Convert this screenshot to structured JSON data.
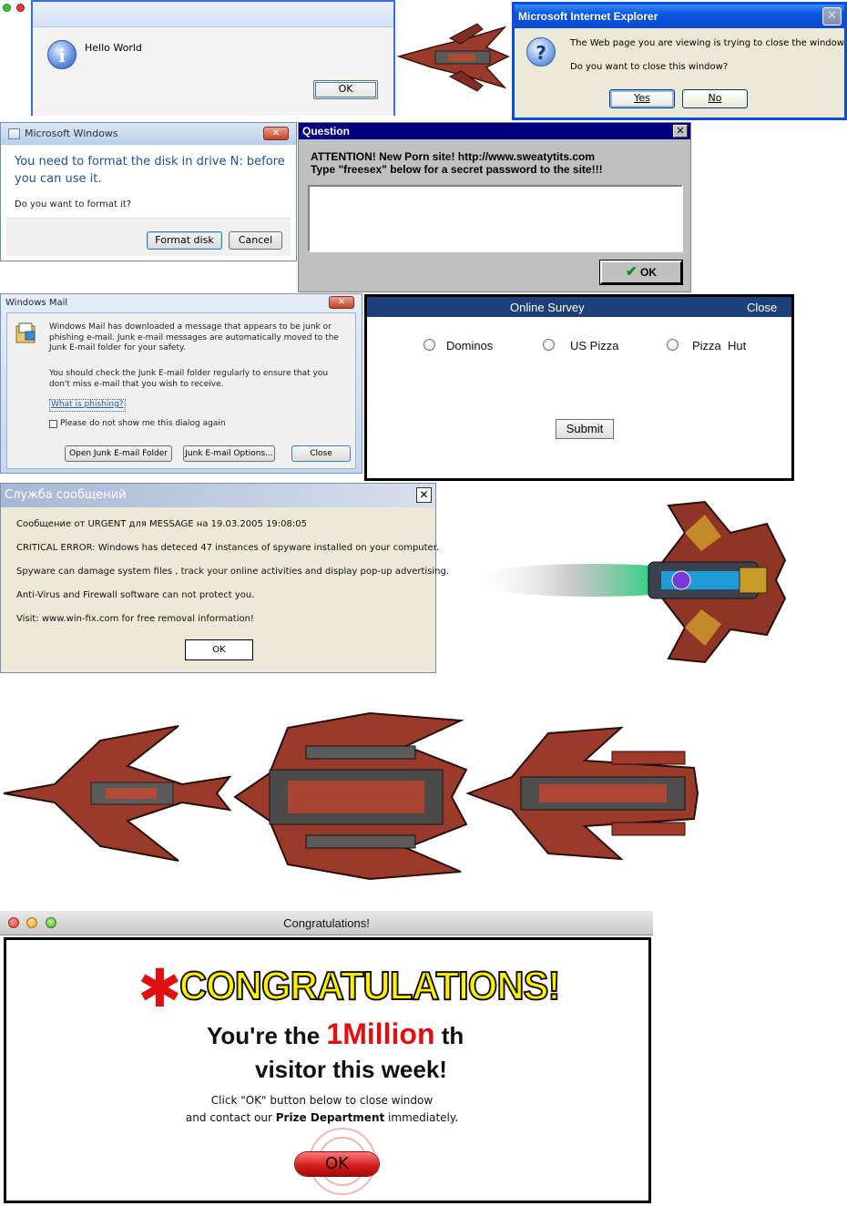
{
  "hello_dialog": {
    "message": "Hello World",
    "ok": "OK",
    "icon": "info-icon"
  },
  "ie_dialog": {
    "title": "Microsoft Internet Explorer",
    "line1": "The Web page you are viewing is trying to close the window.",
    "line2": "Do you want to close this window?",
    "yes": "Yes",
    "no": "No",
    "close": "✕",
    "icon": "question-icon"
  },
  "format_dialog": {
    "title": "Microsoft Windows",
    "heading": "You need to format the disk in drive N: before you can use it.",
    "question": "Do you want to format it?",
    "format": "Format disk",
    "cancel": "Cancel",
    "close": "✕"
  },
  "question_dialog": {
    "title": "Question",
    "line1": "ATTENTION! New Porn site! http://www.sweatytits.com",
    "line2": "Type \"freesex\" below for a secret password to the site!!!",
    "input_value": "",
    "ok": "OK",
    "close": "✕"
  },
  "mail_dialog": {
    "title": "Windows Mail",
    "para1": "Windows Mail has downloaded a message that appears to be junk or phishing e-mail. Junk e-mail messages are automatically moved to the Junk E-mail folder for your safety.",
    "para2": "You should check the Junk E-mail folder regularly to ensure that you don't miss e-mail that you wish to receive.",
    "link": "What is phishing?",
    "checkbox": "Please do not show me this dialog again",
    "btn_open": "Open Junk E-mail Folder",
    "btn_options": "Junk E-mail Options...",
    "btn_close": "Close",
    "close": "✕"
  },
  "survey": {
    "title": "Online Survey",
    "close": "Close",
    "options": [
      "Dominos",
      "US Pizza",
      "Pizza  Hut"
    ],
    "submit": "Submit"
  },
  "ru_dialog": {
    "title": "Служба сообщений",
    "close": "✕",
    "lines": [
      "Сообщение от URGENT для MESSAGE на 19.03.2005 19:08:05",
      "CRITICAL ERROR: Windows has deteced 47 instances of spyware installed on your computer.",
      "Spyware can damage system files , track your online activities and display pop-up advertising.",
      "Anti-Virus and Firewall software can not protect you.",
      "Visit:  www.win-fix.com  for free removal information!"
    ],
    "ok": "OK"
  },
  "mac_dialog": {
    "title": "Congratulations!",
    "headline": "CONGRATULATIONS!",
    "line1_pre": "You're the ",
    "million": "1Million",
    "line1_post": " th",
    "line2": "visitor this week!",
    "small1": "Click \"OK\" button below to close window",
    "small2_pre": "and contact our ",
    "small2_bold": "Prize Department",
    "small2_post": " immediately.",
    "ok": "OK"
  },
  "colors": {
    "xp_blue": "#0a55e0",
    "classic_navy": "#000080",
    "survey_bar": "#1d3f7a",
    "ship_red": "#9a3a2a",
    "congrats_yellow": "#ffef00",
    "mac_red": "#e01010"
  }
}
